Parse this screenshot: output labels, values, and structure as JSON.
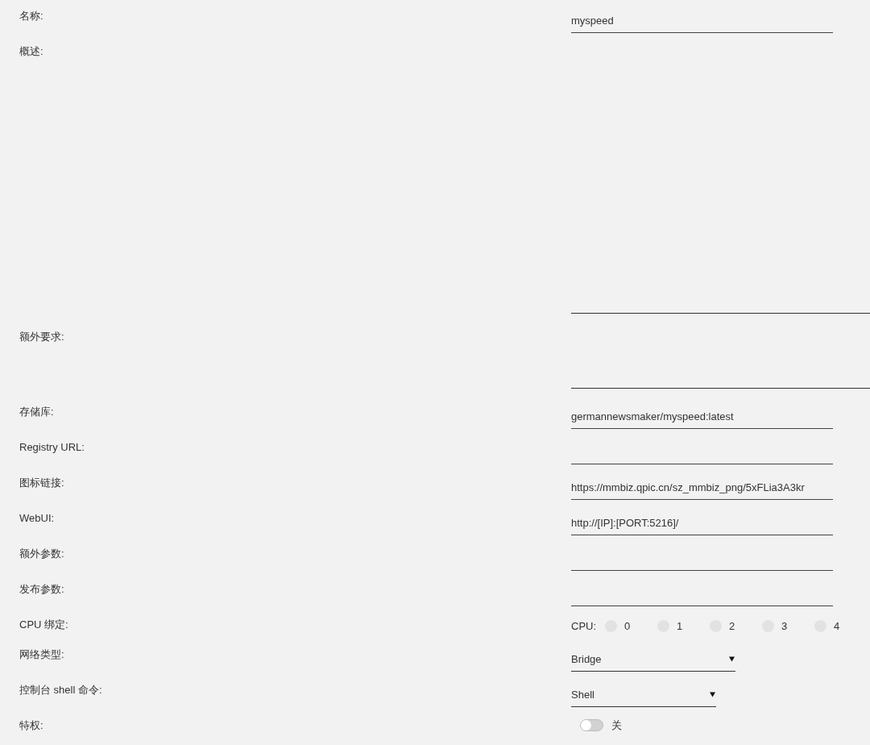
{
  "form": {
    "fields": [
      {
        "kind": "text",
        "label": "名称:",
        "value": "myspeed"
      },
      {
        "kind": "textarea",
        "label": "概述:"
      },
      {
        "kind": "textarea",
        "label": "额外要求:"
      },
      {
        "kind": "text",
        "label": "存储库:",
        "value": "germannewsmaker/myspeed:latest"
      },
      {
        "kind": "text",
        "label": "Registry URL:"
      },
      {
        "kind": "text",
        "label": "图标链接:",
        "value": "https://mmbiz.qpic.cn/sz_mmbiz_png/5xFLia3A3kr"
      },
      {
        "kind": "text",
        "label": "WebUI:",
        "value": "http://[IP]:[PORT:5216]/"
      },
      {
        "kind": "text",
        "label": "额外参数:"
      },
      {
        "kind": "text",
        "label": "发布参数:"
      },
      {
        "kind": "cpu",
        "label": "CPU 绑定:",
        "prefix": "CPU:",
        "options": [
          {
            "label": "0",
            "checked": false
          },
          {
            "label": "1",
            "checked": false
          },
          {
            "label": "2",
            "checked": false
          },
          {
            "label": "3",
            "checked": false
          },
          {
            "label": "4",
            "checked": false
          }
        ]
      },
      {
        "kind": "select",
        "label": "网络类型:",
        "value": "Bridge"
      },
      {
        "kind": "select",
        "label": "控制台 shell 命令:",
        "value": "Shell"
      },
      {
        "kind": "toggle",
        "label": "特权:",
        "on": false,
        "state_label": "关"
      }
    ]
  }
}
